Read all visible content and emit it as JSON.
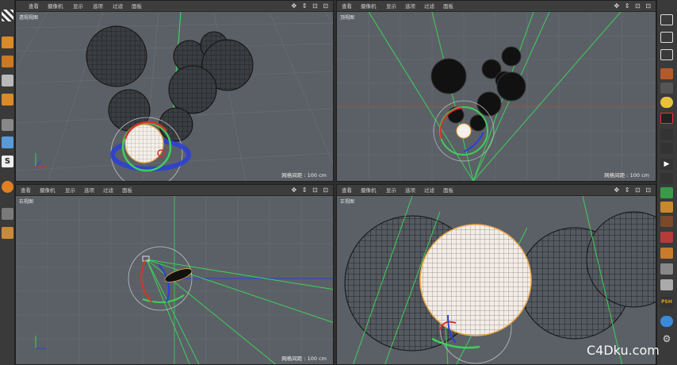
{
  "viewport_menu": [
    "查看",
    "摄像机",
    "显示",
    "选项",
    "过滤",
    "面板"
  ],
  "viewports": {
    "perspective": {
      "label": "透视视图",
      "scale": "网格间距 : 100 cm"
    },
    "top": {
      "label": "顶视图",
      "scale": "网格间距 : 100 cm"
    },
    "right": {
      "label": "右视图",
      "scale": "网格间距 : 100 cm"
    },
    "front": {
      "label": "正视图",
      "scale": "网格间距 : 100 cm"
    }
  },
  "nav_icons": "✥ ⇕ ⊡ ⊡",
  "watermark": "C4Dku.com",
  "colors": {
    "viewport_bg": "#5b6066",
    "grid": "#6b7178",
    "axis_green": "#3fcf5a",
    "axis_red": "#d9322a",
    "axis_blue": "#2a3fd9",
    "selection": "#f0a848"
  },
  "icons": {
    "left_toolbar": [
      "checker-icon",
      "cube-icon",
      "cube-icon",
      "cube-icon",
      "cube-icon",
      "snap-icon",
      "mouse-icon",
      "ring-icon",
      "s-icon",
      "magnet-icon",
      "lock-icon",
      "layer-icon"
    ],
    "right_toolbar": [
      "plus-icon",
      "move-icon",
      "scale-icon",
      "rotate-icon",
      "camera-icon",
      "lightbulb-icon",
      "film-icon",
      "film-icon",
      "render-icon",
      "film-icon",
      "play-icon",
      "film-icon",
      "brush-icon",
      "pen-icon",
      "paint-icon",
      "grid-icon",
      "tool-icon",
      "tool-icon",
      "wand-icon",
      "shape-icon",
      "psh-icon",
      "globe-icon",
      "gear-icon"
    ]
  }
}
